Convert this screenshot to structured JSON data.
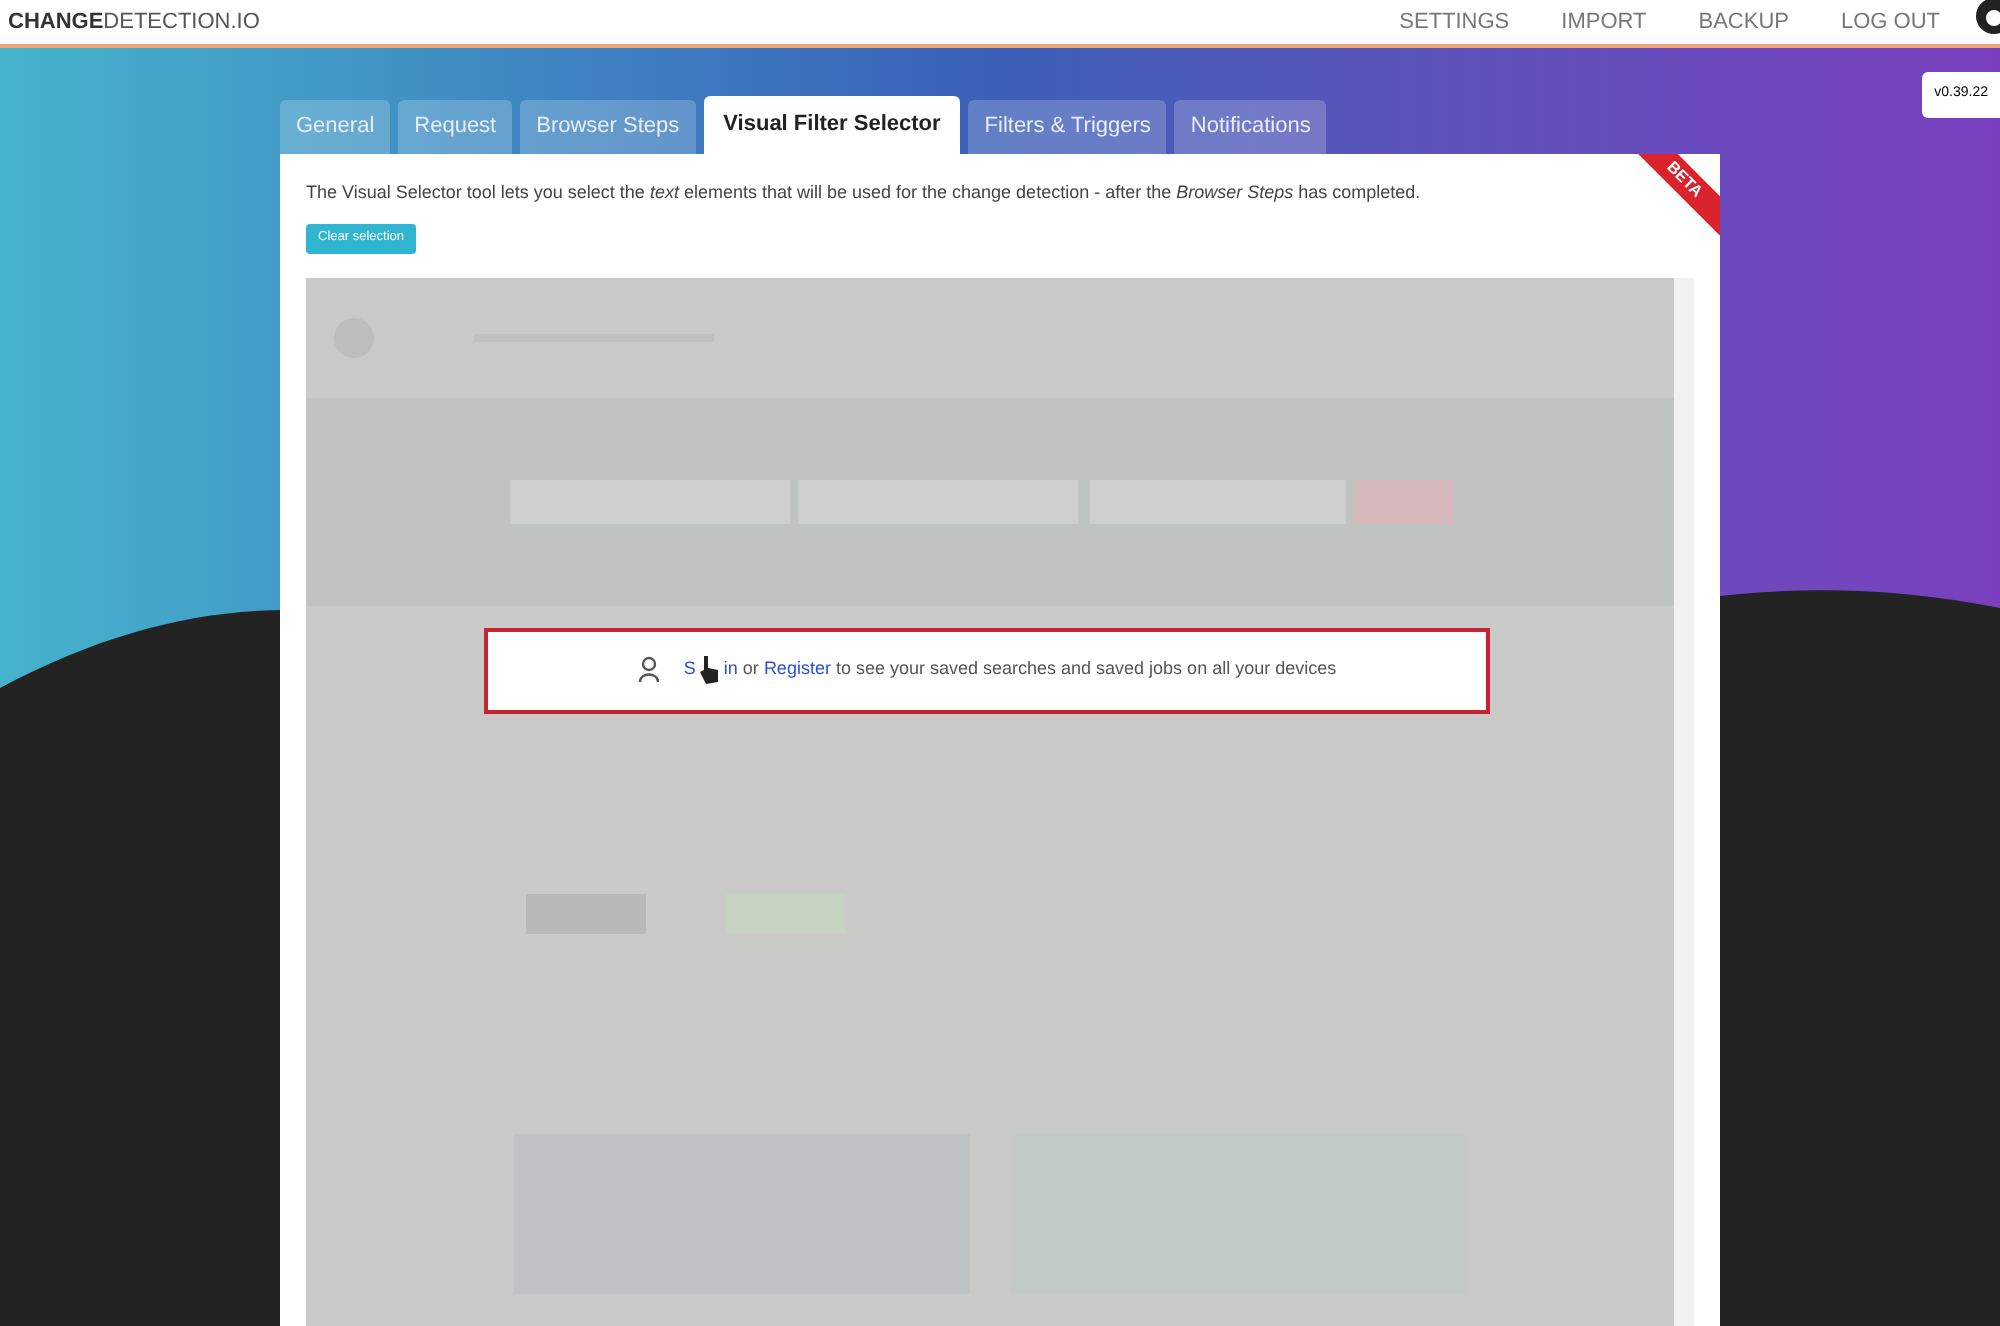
{
  "header": {
    "logo_bold": "CHANGE",
    "logo_rest": "DETECTION.IO",
    "nav": [
      "SETTINGS",
      "IMPORT",
      "BACKUP",
      "LOG OUT"
    ],
    "version": "v0.39.22"
  },
  "tabs": [
    {
      "label": "General",
      "selected": false
    },
    {
      "label": "Request",
      "selected": false
    },
    {
      "label": "Browser Steps",
      "selected": false
    },
    {
      "label": "Visual Filter Selector",
      "selected": true
    },
    {
      "label": "Filters & Triggers",
      "selected": false
    },
    {
      "label": "Notifications",
      "selected": false
    }
  ],
  "panel": {
    "ribbon": "BETA",
    "description": "The Visual Selector tool lets you select the *text* elements that will be used for the change detection - after the *Browser Steps* has completed.",
    "button": "Clear selection",
    "preview": {
      "highlight_lead": "S",
      "highlight": [
        {
          "kind": "link",
          "text": "in"
        },
        {
          "kind": "text",
          "text": " or "
        },
        {
          "kind": "link",
          "text": "Register"
        },
        {
          "kind": "text",
          "text": " to see your saved searches and saved jobs on all your devices"
        }
      ]
    }
  }
}
